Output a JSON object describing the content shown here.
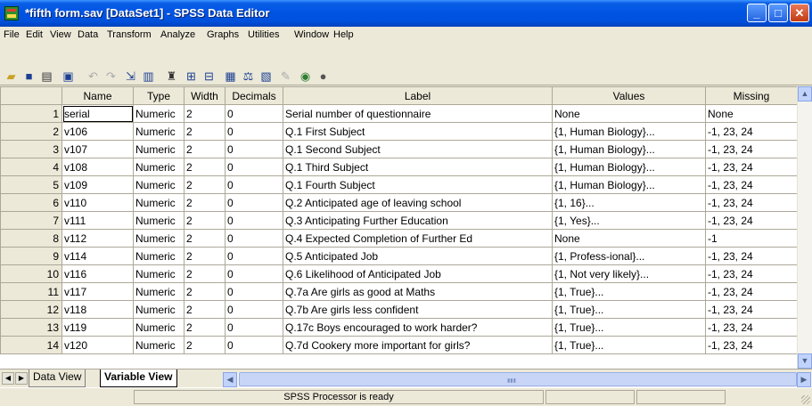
{
  "window": {
    "title": "*fifth form.sav [DataSet1] - SPSS Data Editor",
    "minimize": "_",
    "maximize": "□",
    "close": "✕"
  },
  "menu": [
    "File",
    "Edit",
    "View",
    "Data",
    "Transform",
    "Analyze",
    "Graphs",
    "Utilities",
    "Window",
    "Help"
  ],
  "toolbar_icons": [
    "open-icon",
    "save-icon",
    "print-icon",
    "dialog-recall-icon",
    "undo-icon",
    "redo-icon",
    "goto-case-icon",
    "variables-icon",
    "find-icon",
    "insert-cases-icon",
    "insert-variable-icon",
    "split-file-icon",
    "weight-cases-icon",
    "select-cases-icon",
    "value-labels-icon",
    "use-sets-icon",
    "show-all-icon"
  ],
  "columns": [
    "Name",
    "Type",
    "Width",
    "Decimals",
    "Label",
    "Values",
    "Missing"
  ],
  "rows": [
    {
      "n": "1",
      "name": "serial",
      "type": "Numeric",
      "width": "2",
      "decimals": "0",
      "label": "Serial number of questionnaire",
      "values": "None",
      "missing": "None"
    },
    {
      "n": "2",
      "name": "v106",
      "type": "Numeric",
      "width": "2",
      "decimals": "0",
      "label": "Q.1  First Subject",
      "values": "{1, Human   Biology}...",
      "missing": "-1, 23, 24"
    },
    {
      "n": "3",
      "name": "v107",
      "type": "Numeric",
      "width": "2",
      "decimals": "0",
      "label": "Q.1  Second Subject",
      "values": "{1, Human   Biology}...",
      "missing": "-1, 23, 24"
    },
    {
      "n": "4",
      "name": "v108",
      "type": "Numeric",
      "width": "2",
      "decimals": "0",
      "label": "Q.1  Third Subject",
      "values": "{1, Human   Biology}...",
      "missing": "-1, 23, 24"
    },
    {
      "n": "5",
      "name": "v109",
      "type": "Numeric",
      "width": "2",
      "decimals": "0",
      "label": "Q.1  Fourth Subject",
      "values": "{1, Human   Biology}...",
      "missing": "-1, 23, 24"
    },
    {
      "n": "6",
      "name": "v110",
      "type": "Numeric",
      "width": "2",
      "decimals": "0",
      "label": "Q.2  Anticipated age of leaving school",
      "values": "{1, 16}...",
      "missing": "-1, 23, 24"
    },
    {
      "n": "7",
      "name": "v111",
      "type": "Numeric",
      "width": "2",
      "decimals": "0",
      "label": "Q.3  Anticipating Further Education",
      "values": "{1, Yes}...",
      "missing": "-1, 23, 24"
    },
    {
      "n": "8",
      "name": "v112",
      "type": "Numeric",
      "width": "2",
      "decimals": "0",
      "label": "Q.4  Expected Completion of Further Ed",
      "values": "None",
      "missing": "-1"
    },
    {
      "n": "9",
      "name": "v114",
      "type": "Numeric",
      "width": "2",
      "decimals": "0",
      "label": "Q.5  Anticipated Job",
      "values": "{1, Profess-ional}...",
      "missing": "-1, 23, 24"
    },
    {
      "n": "10",
      "name": "v116",
      "type": "Numeric",
      "width": "2",
      "decimals": "0",
      "label": "Q.6  Likelihood of Anticipated Job",
      "values": "{1, Not very likely}...",
      "missing": "-1, 23, 24"
    },
    {
      "n": "11",
      "name": "v117",
      "type": "Numeric",
      "width": "2",
      "decimals": "0",
      "label": "Q.7a Are girls as good at Maths",
      "values": "{1, True}...",
      "missing": "-1, 23, 24"
    },
    {
      "n": "12",
      "name": "v118",
      "type": "Numeric",
      "width": "2",
      "decimals": "0",
      "label": "Q.7b Are girls less confident",
      "values": "{1, True}...",
      "missing": "-1, 23, 24"
    },
    {
      "n": "13",
      "name": "v119",
      "type": "Numeric",
      "width": "2",
      "decimals": "0",
      "label": "Q.17c Boys encouraged to work harder?",
      "values": "{1, True}...",
      "missing": "-1, 23, 24"
    },
    {
      "n": "14",
      "name": "v120",
      "type": "Numeric",
      "width": "2",
      "decimals": "0",
      "label": "Q.7d Cookery more important for girls?",
      "values": "{1, True}...",
      "missing": "-1, 23, 24"
    }
  ],
  "tabs": {
    "data_view": "Data View",
    "variable_view": "Variable View"
  },
  "status": "SPSS Processor  is ready"
}
